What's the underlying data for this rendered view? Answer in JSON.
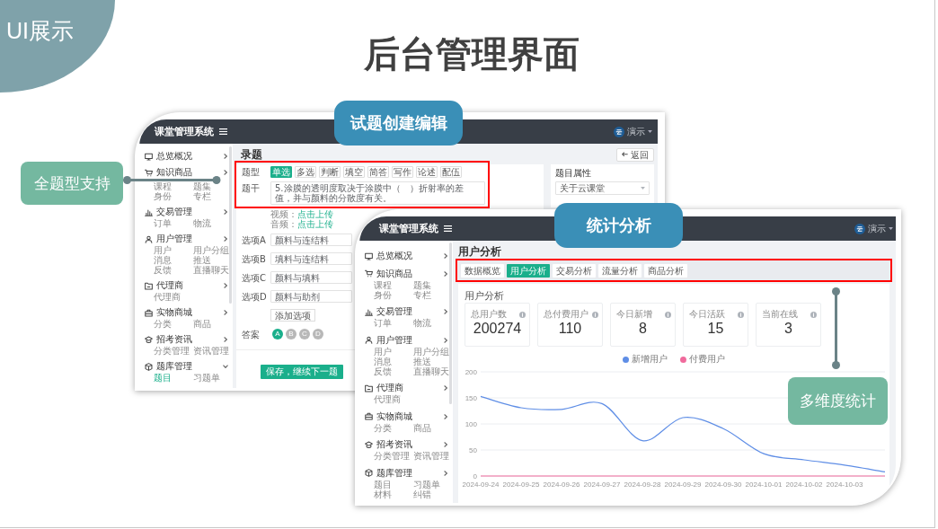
{
  "badge": "UI展示",
  "title": "后台管理界面",
  "editor": {
    "app_title": "课堂管理系统",
    "user": "演示",
    "sidebar": [
      {
        "label": "总览概况",
        "expanded": false
      },
      {
        "label": "知识商品",
        "expanded": false,
        "children": [
          {
            "label": "课程",
            "selected": false
          },
          {
            "label": "题集",
            "selected": false
          },
          {
            "label": "身份",
            "selected": false
          },
          {
            "label": "专栏",
            "selected": false
          }
        ]
      },
      {
        "label": "交易管理",
        "expanded": false,
        "children": [
          {
            "label": "订单",
            "selected": false
          },
          {
            "label": "物流",
            "selected": false
          }
        ]
      },
      {
        "label": "用户管理",
        "expanded": false,
        "children": [
          {
            "label": "用户",
            "selected": false
          },
          {
            "label": "用户分组",
            "selected": false
          },
          {
            "label": "消息",
            "selected": false
          },
          {
            "label": "推送",
            "selected": false
          },
          {
            "label": "反馈",
            "selected": false
          },
          {
            "label": "直播聊天",
            "selected": false
          }
        ]
      },
      {
        "label": "代理商",
        "expanded": false,
        "children": [
          {
            "label": "代理商",
            "selected": false
          }
        ]
      },
      {
        "label": "实物商城",
        "expanded": false,
        "children": [
          {
            "label": "分类",
            "selected": false
          },
          {
            "label": "商品",
            "selected": false
          }
        ]
      },
      {
        "label": "招考资讯",
        "expanded": false,
        "children": [
          {
            "label": "分类管理",
            "selected": false
          },
          {
            "label": "资讯管理",
            "selected": false
          }
        ]
      },
      {
        "label": "题库管理",
        "expanded": true,
        "children": [
          {
            "label": "题目",
            "selected": true
          },
          {
            "label": "习题单",
            "selected": false
          }
        ]
      }
    ],
    "page_title": "录题",
    "back_button": "返回",
    "form": {
      "type_label": "题型",
      "types": [
        {
          "label": "单选",
          "selected": true
        },
        {
          "label": "多选",
          "selected": false
        },
        {
          "label": "判断",
          "selected": false
        },
        {
          "label": "填空",
          "selected": false
        },
        {
          "label": "简答",
          "selected": false
        },
        {
          "label": "写作",
          "selected": false
        },
        {
          "label": "论述",
          "selected": false
        },
        {
          "label": "配伍",
          "selected": false
        }
      ],
      "stem_label": "题干",
      "stem_value": "5.涂膜的透明度取决于涂膜中（　）折射率的差值，并与颜料的分散度有关。",
      "uploads": [
        {
          "label": "视频：",
          "link": "点击上传"
        },
        {
          "label": "音频：",
          "link": "点击上传"
        }
      ],
      "options": [
        {
          "label": "选项A",
          "value": "颜料与连结料"
        },
        {
          "label": "选项B",
          "value": "填料与连结料"
        },
        {
          "label": "选项C",
          "value": "颜料与填料"
        },
        {
          "label": "选项D",
          "value": "颜料与助剂"
        }
      ],
      "add_option_button": "添加选项",
      "answer_label": "答案",
      "answers": [
        {
          "label": "A",
          "selected": true
        },
        {
          "label": "B",
          "selected": false
        },
        {
          "label": "C",
          "selected": false
        },
        {
          "label": "D",
          "selected": false
        }
      ],
      "save_button": "保存，继续下一题"
    },
    "properties": {
      "title": "题目属性",
      "select_value": "关于云课堂"
    }
  },
  "analytics": {
    "app_title": "课堂管理系统",
    "user": "演示",
    "sidebar": [
      {
        "label": "总览概况",
        "expanded": false
      },
      {
        "label": "知识商品",
        "expanded": false,
        "children": [
          {
            "label": "课程",
            "selected": false
          },
          {
            "label": "题集",
            "selected": false
          },
          {
            "label": "身份",
            "selected": false
          },
          {
            "label": "专栏",
            "selected": false
          }
        ]
      },
      {
        "label": "交易管理",
        "expanded": false,
        "children": [
          {
            "label": "订单",
            "selected": false
          },
          {
            "label": "物流",
            "selected": false
          }
        ]
      },
      {
        "label": "用户管理",
        "expanded": false,
        "children": [
          {
            "label": "用户",
            "selected": false
          },
          {
            "label": "用户分组",
            "selected": false
          },
          {
            "label": "消息",
            "selected": false
          },
          {
            "label": "推送",
            "selected": false
          },
          {
            "label": "反馈",
            "selected": false
          },
          {
            "label": "直播聊天",
            "selected": false
          }
        ]
      },
      {
        "label": "代理商",
        "expanded": false,
        "children": [
          {
            "label": "代理商",
            "selected": false
          }
        ]
      },
      {
        "label": "实物商城",
        "expanded": false,
        "children": [
          {
            "label": "分类",
            "selected": false
          },
          {
            "label": "商品",
            "selected": false
          }
        ]
      },
      {
        "label": "招考资讯",
        "expanded": false,
        "children": [
          {
            "label": "分类管理",
            "selected": false
          },
          {
            "label": "资讯管理",
            "selected": false
          }
        ]
      },
      {
        "label": "题库管理",
        "expanded": false,
        "children": [
          {
            "label": "题目",
            "selected": false
          },
          {
            "label": "习题单",
            "selected": false
          },
          {
            "label": "材料",
            "selected": false
          },
          {
            "label": "纠错",
            "selected": false
          }
        ]
      }
    ],
    "page_title": "用户分析",
    "tabs": [
      {
        "label": "数据概览",
        "selected": false
      },
      {
        "label": "用户分析",
        "selected": true
      },
      {
        "label": "交易分析",
        "selected": false
      },
      {
        "label": "流量分析",
        "selected": false
      },
      {
        "label": "商品分析",
        "selected": false
      }
    ],
    "section_title": "用户分析",
    "stats": [
      {
        "label": "总用户数",
        "value": "200274"
      },
      {
        "label": "总付费用户",
        "value": "110"
      },
      {
        "label": "今日新增",
        "value": "8"
      },
      {
        "label": "今日活跃",
        "value": "15"
      },
      {
        "label": "当前在线",
        "value": "3"
      }
    ],
    "chart_data": {
      "type": "line",
      "categories": [
        "2024-09-24",
        "2024-09-25",
        "2024-09-26",
        "2024-09-27",
        "2024-09-28",
        "2024-09-29",
        "2024-09-30",
        "2024-10-01",
        "2024-10-02",
        "2024-10-03",
        null
      ],
      "series": [
        {
          "name": "新增用户",
          "color": "#5f8ee6",
          "values": [
            153,
            131,
            128,
            139,
            68,
            112,
            91,
            43,
            31,
            21,
            8
          ]
        },
        {
          "name": "付费用户",
          "color": "#f06a9c",
          "values": [
            0,
            0,
            0,
            0,
            0,
            0,
            0,
            0,
            0,
            0,
            0
          ]
        }
      ],
      "ylim": [
        0,
        200
      ],
      "yticks": [
        0,
        50,
        100,
        150,
        200
      ],
      "grid": true,
      "legend": "top"
    }
  },
  "callouts": [
    {
      "label": "试题创建编辑",
      "kind": "banner"
    },
    {
      "label": "统计分析",
      "kind": "banner"
    },
    {
      "label": "全题型支持",
      "kind": "note"
    },
    {
      "label": "多维度统计",
      "kind": "note"
    }
  ]
}
